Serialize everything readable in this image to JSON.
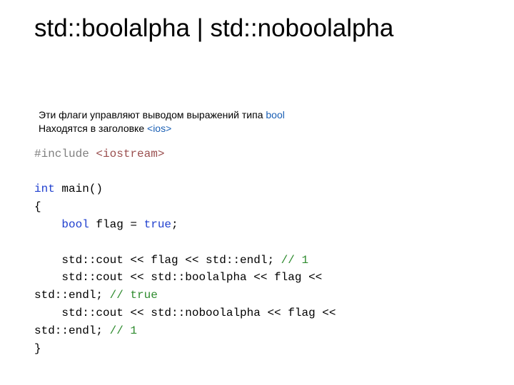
{
  "title": "std::boolalpha | std::noboolalpha",
  "desc": {
    "l1_a": "Эти флаги управляют выводом выражений типа ",
    "l1_b": "bool",
    "l2_a": "Находятся в заголовке ",
    "l2_b": "<ios>"
  },
  "code": {
    "inc_a": "#include",
    "inc_b": " <iostream>",
    "kw_int": "int",
    "main_sig": " main()",
    "brace_open": "{",
    "pad4": "    ",
    "kw_bool": "bool",
    "flag_decl_a": " flag = ",
    "kw_true": "true",
    "semi": ";",
    "blank": "",
    "l_cout1_a": "std::cout << flag << std::endl; ",
    "l_cout1_c": "// 1",
    "l_cout2_a": "std::cout << std::boolalpha << flag << ",
    "l_cout2_b": "std::endl; ",
    "l_cout2_c": "// true",
    "l_cout3_a": "std::cout << std::noboolalpha << flag << ",
    "l_cout3_b": "std::endl; ",
    "l_cout3_c": "// 1",
    "brace_close": "}"
  }
}
